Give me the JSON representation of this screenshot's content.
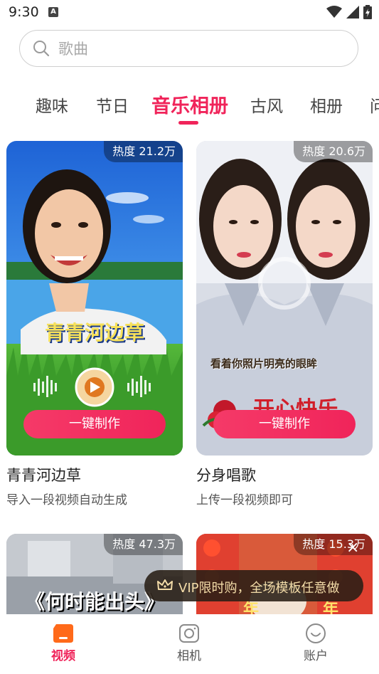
{
  "status_bar": {
    "time": "9:30",
    "notification_glyph": "A"
  },
  "search": {
    "placeholder": "歌曲"
  },
  "tabs": [
    {
      "label": "趣味"
    },
    {
      "label": "节日"
    },
    {
      "label": "音乐相册",
      "active": true
    },
    {
      "label": "古风"
    },
    {
      "label": "相册"
    },
    {
      "label": "问"
    }
  ],
  "cards": [
    {
      "heat": "热度 21.2万",
      "overlay_text": "青青河边草",
      "button": "一键制作",
      "title": "青青河边草",
      "subtitle": "导入一段视频自动生成"
    },
    {
      "heat": "热度 20.6万",
      "overlay_text": "看着你照片明亮的眼眸",
      "overlay_text2": "开心快乐",
      "button": "一键制作",
      "title": "分身唱歌",
      "subtitle": "上传一段视频即可"
    },
    {
      "heat": "热度 47.3万",
      "overlay_text": "《何时能出头》"
    },
    {
      "heat": "热度 15.3万",
      "overlay_text": "年"
    }
  ],
  "vip_toast": {
    "text": "VIP限时购，全场模板任意做",
    "close": "×"
  },
  "bottom_nav": [
    {
      "label": "视频",
      "icon": "video-icon",
      "active": true
    },
    {
      "label": "相机",
      "icon": "camera-icon"
    },
    {
      "label": "账户",
      "icon": "account-icon"
    }
  ],
  "colors": {
    "accent": "#f0245a",
    "vip_text": "#f3dca8"
  }
}
